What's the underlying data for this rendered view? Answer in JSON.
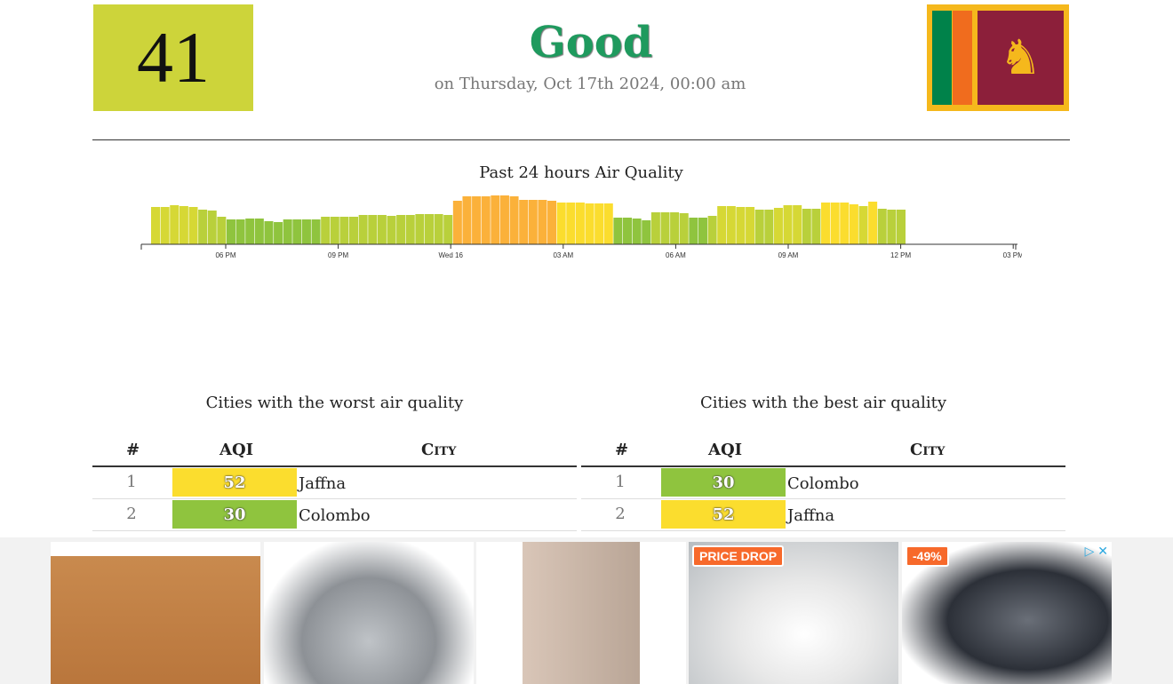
{
  "current": {
    "aqi": "41",
    "status": "Good",
    "status_color": "#1f9a5e",
    "aqi_color": "#cdd43a",
    "date": "on Thursday, Oct 17th 2024, 00:00 am"
  },
  "flag": {
    "country": "Sri Lanka"
  },
  "chart_data": {
    "type": "bar",
    "title": "Past 24 hours Air Quality",
    "x_ticks": [
      "06 PM",
      "09 PM",
      "Wed 16",
      "03 AM",
      "06 AM",
      "09 AM",
      "12 PM",
      "03 PM"
    ],
    "values": [
      42,
      42,
      44,
      43,
      42,
      39,
      38,
      31,
      28,
      28,
      29,
      29,
      26,
      25,
      28,
      28,
      28,
      28,
      31,
      31,
      31,
      31,
      33,
      33,
      33,
      32,
      33,
      33,
      34,
      34,
      34,
      33,
      49,
      54,
      54,
      54,
      55,
      55,
      54,
      50,
      50,
      50,
      49,
      47,
      47,
      47,
      46,
      46,
      46,
      30,
      30,
      29,
      27,
      36,
      36,
      36,
      35,
      30,
      30,
      32,
      43,
      43,
      42,
      42,
      39,
      39,
      41,
      44,
      44,
      40,
      40,
      47,
      47,
      47,
      45,
      43,
      48,
      40,
      39,
      39
    ],
    "ylim": [
      0,
      60
    ]
  },
  "worst": {
    "title": "Cities with the worst air quality",
    "headers": {
      "rank": "#",
      "aqi": "AQI",
      "city": "City"
    },
    "rows": [
      {
        "rank": "1",
        "aqi": "52",
        "city": "Jaffna",
        "color": "#fbdd2e"
      },
      {
        "rank": "2",
        "aqi": "30",
        "city": "Colombo",
        "color": "#8fc43e"
      }
    ]
  },
  "best": {
    "title": "Cities with the best air quality",
    "headers": {
      "rank": "#",
      "aqi": "AQI",
      "city": "City"
    },
    "rows": [
      {
        "rank": "1",
        "aqi": "30",
        "city": "Colombo",
        "color": "#8fc43e"
      },
      {
        "rank": "2",
        "aqi": "52",
        "city": "Jaffna",
        "color": "#fbdd2e"
      }
    ]
  },
  "ads": {
    "items": [
      {
        "badge": ""
      },
      {
        "badge": ""
      },
      {
        "badge": ""
      },
      {
        "badge": "PRICE DROP"
      },
      {
        "badge": "-49%"
      }
    ],
    "adchoices_icon": "adchoices-icon",
    "close_icon": "close-icon"
  }
}
